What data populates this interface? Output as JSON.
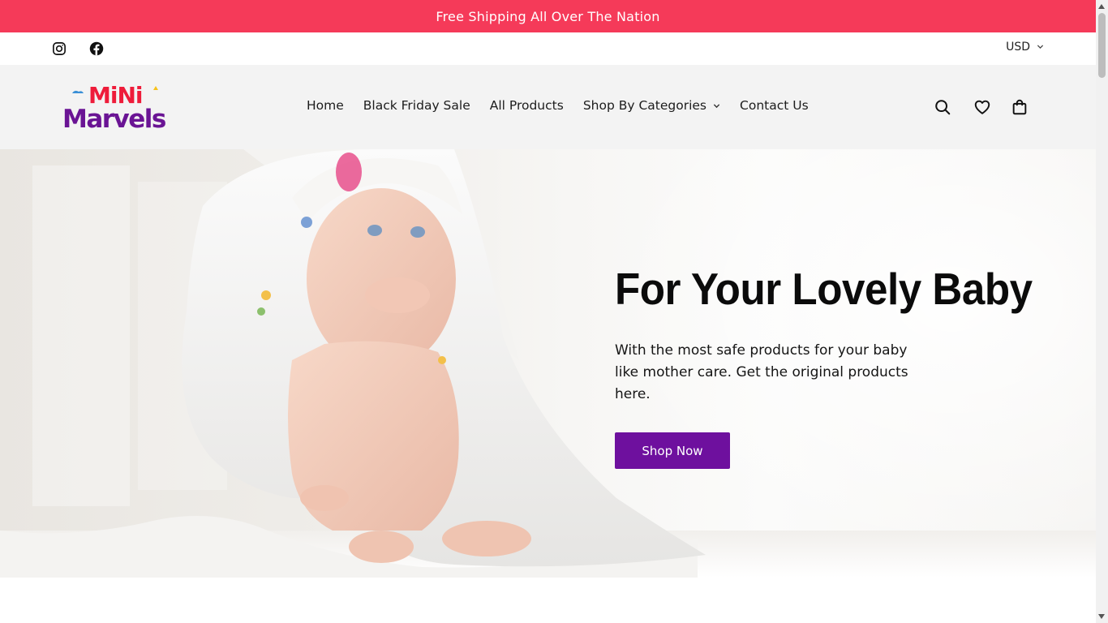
{
  "announcement": {
    "text": "Free Shipping All Over The Nation"
  },
  "utility_bar": {
    "social": [
      {
        "icon": "instagram-icon"
      },
      {
        "icon": "facebook-icon"
      }
    ],
    "currency": {
      "selected": "USD"
    }
  },
  "header": {
    "logo": {
      "line1": "MiNi",
      "line2": "Marvels"
    },
    "nav": [
      {
        "label": "Home"
      },
      {
        "label": "Black Friday Sale"
      },
      {
        "label": "All Products"
      },
      {
        "label": "Shop By Categories",
        "has_dropdown": true
      },
      {
        "label": "Contact Us"
      }
    ],
    "icons": [
      "search-icon",
      "heart-icon",
      "cart-icon"
    ]
  },
  "hero": {
    "title": "For Your Lovely Baby",
    "subtitle": "With the most safe products for your baby like mother care. Get the original products here.",
    "button": "Shop Now"
  },
  "colors": {
    "announcement_bg": "#f53a59",
    "header_bg": "#f3f3f3",
    "button_bg": "#6e109e",
    "logo_red": "#ee1c3a",
    "logo_purple": "#6a1494"
  }
}
